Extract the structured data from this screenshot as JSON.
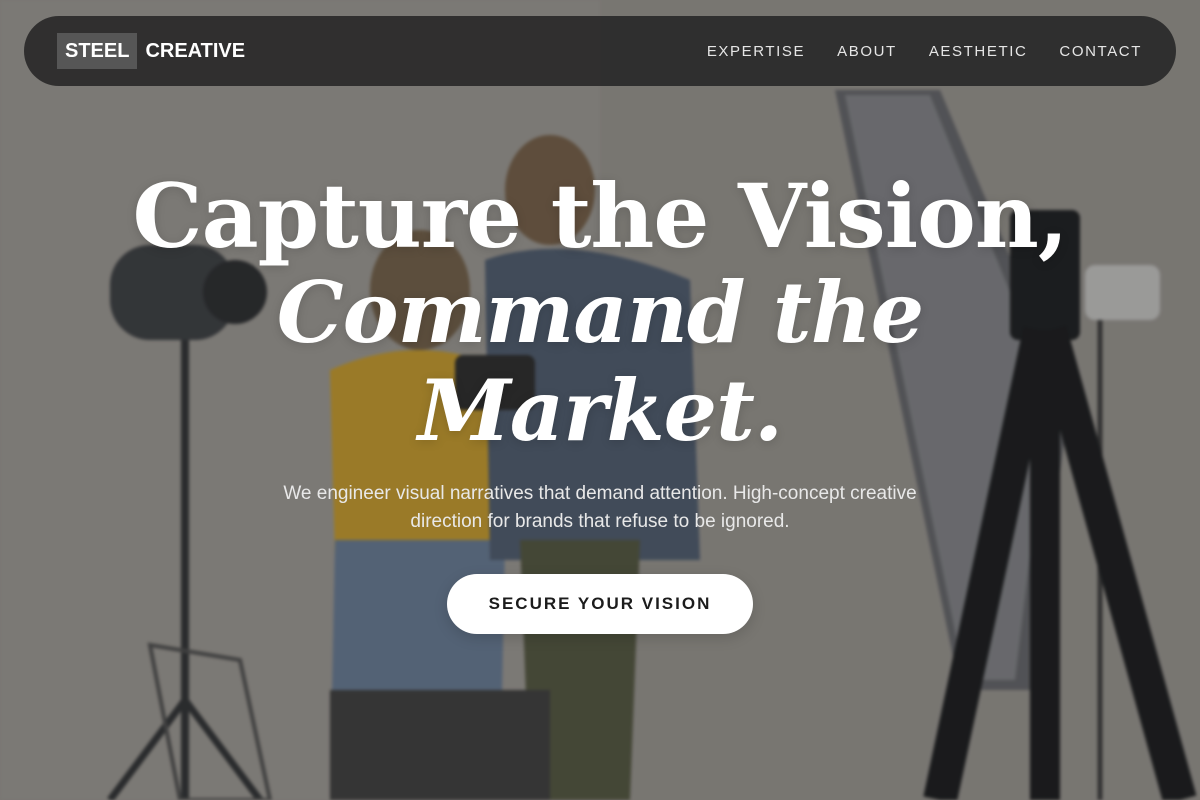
{
  "brand": {
    "logo_box": "STEEL",
    "logo_text": "CREATIVE"
  },
  "nav": {
    "items": [
      {
        "label": "EXPERTISE"
      },
      {
        "label": "ABOUT"
      },
      {
        "label": "AESTHETIC"
      },
      {
        "label": "CONTACT"
      }
    ]
  },
  "hero": {
    "headline_line1": "Capture the Vision,",
    "headline_line2": "Command the",
    "headline_line3": "Market.",
    "subtext": "We engineer visual narratives that demand attention. High-concept creative direction for brands that refuse to be ignored.",
    "cta_label": "SECURE YOUR VISION"
  },
  "colors": {
    "navbar_bg": "#2a2a2a",
    "logo_box_bg": "#565656",
    "cta_bg": "#ffffff",
    "cta_text": "#1c1c1c",
    "headline": "#ffffff"
  }
}
